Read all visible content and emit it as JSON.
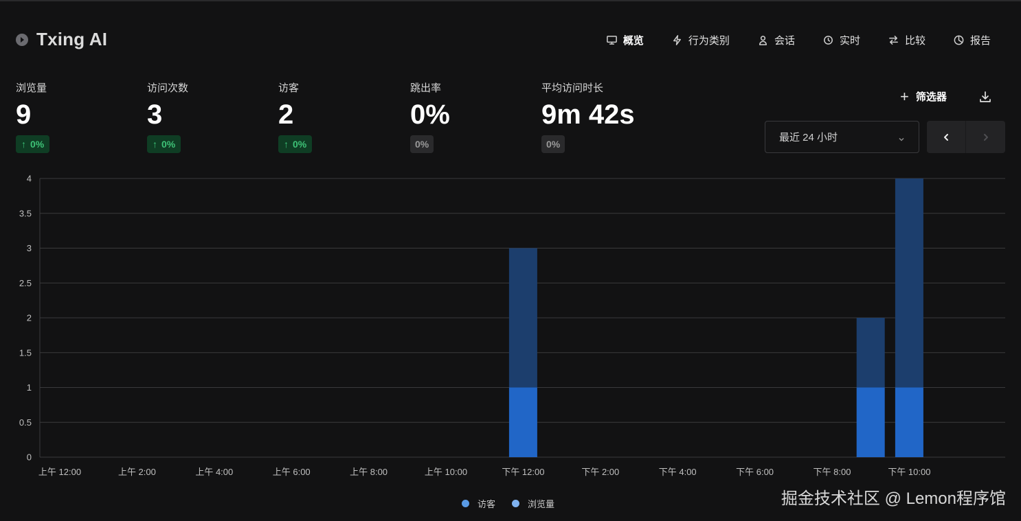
{
  "app": {
    "title": "Txing AI"
  },
  "nav": [
    {
      "label": "概览",
      "icon": "monitor-icon",
      "active": true
    },
    {
      "label": "行为类别",
      "icon": "lightning-icon",
      "active": false
    },
    {
      "label": "会话",
      "icon": "user-icon",
      "active": false
    },
    {
      "label": "实时",
      "icon": "clock-icon",
      "active": false
    },
    {
      "label": "比较",
      "icon": "swap-arrows-icon",
      "active": false
    },
    {
      "label": "报告",
      "icon": "pie-chart-icon",
      "active": false
    }
  ],
  "metrics": [
    {
      "label": "浏览量",
      "value": "9",
      "change": "0%",
      "trend": "up"
    },
    {
      "label": "访问次数",
      "value": "3",
      "change": "0%",
      "trend": "up"
    },
    {
      "label": "访客",
      "value": "2",
      "change": "0%",
      "trend": "up"
    },
    {
      "label": "跳出率",
      "value": "0%",
      "change": "0%",
      "trend": "flat"
    },
    {
      "label": "平均访问时长",
      "value": "9m 42s",
      "change": "0%",
      "trend": "flat"
    }
  ],
  "controls": {
    "filter_label": "筛选器",
    "range_label": "最近 24 小时"
  },
  "colors": {
    "visitors": "#2166c7",
    "pageviews": "#1c3e6d",
    "legend_visitors": "#5a9be6",
    "legend_pageviews": "#7fb2f0",
    "up_badge_bg": "#0f3d24",
    "up_badge_text": "#3ec277"
  },
  "chart_data": {
    "type": "bar",
    "stacked": true,
    "x": [
      "上午 12:00",
      "上午 2:00",
      "上午 4:00",
      "上午 6:00",
      "上午 8:00",
      "上午 10:00",
      "下午 12:00",
      "下午 2:00",
      "下午 4:00",
      "下午 6:00",
      "下午 8:00",
      "下午 10:00"
    ],
    "series": [
      {
        "name": "访客",
        "points": [
          {
            "hour": 12,
            "value": 1
          },
          {
            "hour": 21,
            "value": 1
          },
          {
            "hour": 22,
            "value": 1
          }
        ]
      },
      {
        "name": "浏览量",
        "points": [
          {
            "hour": 12,
            "value": 2
          },
          {
            "hour": 21,
            "value": 1
          },
          {
            "hour": 22,
            "value": 3
          }
        ]
      }
    ],
    "ylim": [
      0,
      4
    ],
    "yticks": [
      "0",
      "0.5",
      "1",
      "1.5",
      "2",
      "2.5",
      "3",
      "3.5",
      "4"
    ],
    "grid": true,
    "legend": "bottom-center"
  },
  "watermark": "掘金技术社区 @ Lemon程序馆"
}
